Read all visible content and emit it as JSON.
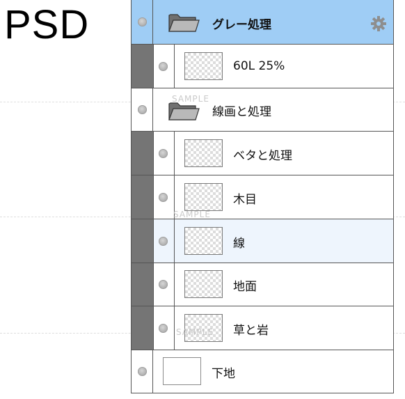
{
  "side_label": "PSD",
  "watermark": "SAMPLE",
  "layers": [
    {
      "name": "グレー処理",
      "type": "folder",
      "selected": true
    },
    {
      "name": "60L 25%",
      "type": "layer"
    },
    {
      "name": "線画と処理",
      "type": "folder"
    },
    {
      "name": "ベタと処理",
      "type": "layer"
    },
    {
      "name": "木目",
      "type": "layer"
    },
    {
      "name": "線",
      "type": "layer"
    },
    {
      "name": "地面",
      "type": "layer"
    },
    {
      "name": "草と岩",
      "type": "layer"
    },
    {
      "name": "下地",
      "type": "layer"
    }
  ],
  "colors": {
    "selected_folder_bg": "#9fcdf5",
    "indent_bar": "#757575"
  },
  "icons": {
    "folder": "folder-icon",
    "visibility": "visibility-dot-icon",
    "settings": "gear-icon"
  }
}
